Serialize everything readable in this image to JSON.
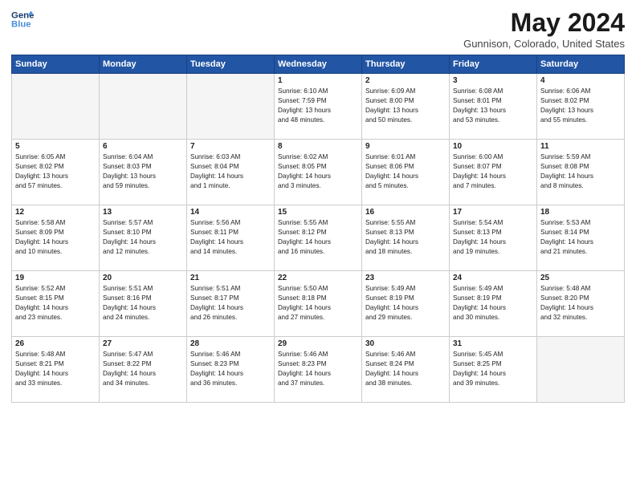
{
  "header": {
    "logo_line1": "General",
    "logo_line2": "Blue",
    "month": "May 2024",
    "location": "Gunnison, Colorado, United States"
  },
  "days_of_week": [
    "Sunday",
    "Monday",
    "Tuesday",
    "Wednesday",
    "Thursday",
    "Friday",
    "Saturday"
  ],
  "weeks": [
    [
      {
        "day": "",
        "info": "",
        "empty": true
      },
      {
        "day": "",
        "info": "",
        "empty": true
      },
      {
        "day": "",
        "info": "",
        "empty": true
      },
      {
        "day": "1",
        "info": "Sunrise: 6:10 AM\nSunset: 7:59 PM\nDaylight: 13 hours\nand 48 minutes.",
        "empty": false
      },
      {
        "day": "2",
        "info": "Sunrise: 6:09 AM\nSunset: 8:00 PM\nDaylight: 13 hours\nand 50 minutes.",
        "empty": false
      },
      {
        "day": "3",
        "info": "Sunrise: 6:08 AM\nSunset: 8:01 PM\nDaylight: 13 hours\nand 53 minutes.",
        "empty": false
      },
      {
        "day": "4",
        "info": "Sunrise: 6:06 AM\nSunset: 8:02 PM\nDaylight: 13 hours\nand 55 minutes.",
        "empty": false
      }
    ],
    [
      {
        "day": "5",
        "info": "Sunrise: 6:05 AM\nSunset: 8:02 PM\nDaylight: 13 hours\nand 57 minutes.",
        "empty": false
      },
      {
        "day": "6",
        "info": "Sunrise: 6:04 AM\nSunset: 8:03 PM\nDaylight: 13 hours\nand 59 minutes.",
        "empty": false
      },
      {
        "day": "7",
        "info": "Sunrise: 6:03 AM\nSunset: 8:04 PM\nDaylight: 14 hours\nand 1 minute.",
        "empty": false
      },
      {
        "day": "8",
        "info": "Sunrise: 6:02 AM\nSunset: 8:05 PM\nDaylight: 14 hours\nand 3 minutes.",
        "empty": false
      },
      {
        "day": "9",
        "info": "Sunrise: 6:01 AM\nSunset: 8:06 PM\nDaylight: 14 hours\nand 5 minutes.",
        "empty": false
      },
      {
        "day": "10",
        "info": "Sunrise: 6:00 AM\nSunset: 8:07 PM\nDaylight: 14 hours\nand 7 minutes.",
        "empty": false
      },
      {
        "day": "11",
        "info": "Sunrise: 5:59 AM\nSunset: 8:08 PM\nDaylight: 14 hours\nand 8 minutes.",
        "empty": false
      }
    ],
    [
      {
        "day": "12",
        "info": "Sunrise: 5:58 AM\nSunset: 8:09 PM\nDaylight: 14 hours\nand 10 minutes.",
        "empty": false
      },
      {
        "day": "13",
        "info": "Sunrise: 5:57 AM\nSunset: 8:10 PM\nDaylight: 14 hours\nand 12 minutes.",
        "empty": false
      },
      {
        "day": "14",
        "info": "Sunrise: 5:56 AM\nSunset: 8:11 PM\nDaylight: 14 hours\nand 14 minutes.",
        "empty": false
      },
      {
        "day": "15",
        "info": "Sunrise: 5:55 AM\nSunset: 8:12 PM\nDaylight: 14 hours\nand 16 minutes.",
        "empty": false
      },
      {
        "day": "16",
        "info": "Sunrise: 5:55 AM\nSunset: 8:13 PM\nDaylight: 14 hours\nand 18 minutes.",
        "empty": false
      },
      {
        "day": "17",
        "info": "Sunrise: 5:54 AM\nSunset: 8:13 PM\nDaylight: 14 hours\nand 19 minutes.",
        "empty": false
      },
      {
        "day": "18",
        "info": "Sunrise: 5:53 AM\nSunset: 8:14 PM\nDaylight: 14 hours\nand 21 minutes.",
        "empty": false
      }
    ],
    [
      {
        "day": "19",
        "info": "Sunrise: 5:52 AM\nSunset: 8:15 PM\nDaylight: 14 hours\nand 23 minutes.",
        "empty": false
      },
      {
        "day": "20",
        "info": "Sunrise: 5:51 AM\nSunset: 8:16 PM\nDaylight: 14 hours\nand 24 minutes.",
        "empty": false
      },
      {
        "day": "21",
        "info": "Sunrise: 5:51 AM\nSunset: 8:17 PM\nDaylight: 14 hours\nand 26 minutes.",
        "empty": false
      },
      {
        "day": "22",
        "info": "Sunrise: 5:50 AM\nSunset: 8:18 PM\nDaylight: 14 hours\nand 27 minutes.",
        "empty": false
      },
      {
        "day": "23",
        "info": "Sunrise: 5:49 AM\nSunset: 8:19 PM\nDaylight: 14 hours\nand 29 minutes.",
        "empty": false
      },
      {
        "day": "24",
        "info": "Sunrise: 5:49 AM\nSunset: 8:19 PM\nDaylight: 14 hours\nand 30 minutes.",
        "empty": false
      },
      {
        "day": "25",
        "info": "Sunrise: 5:48 AM\nSunset: 8:20 PM\nDaylight: 14 hours\nand 32 minutes.",
        "empty": false
      }
    ],
    [
      {
        "day": "26",
        "info": "Sunrise: 5:48 AM\nSunset: 8:21 PM\nDaylight: 14 hours\nand 33 minutes.",
        "empty": false
      },
      {
        "day": "27",
        "info": "Sunrise: 5:47 AM\nSunset: 8:22 PM\nDaylight: 14 hours\nand 34 minutes.",
        "empty": false
      },
      {
        "day": "28",
        "info": "Sunrise: 5:46 AM\nSunset: 8:23 PM\nDaylight: 14 hours\nand 36 minutes.",
        "empty": false
      },
      {
        "day": "29",
        "info": "Sunrise: 5:46 AM\nSunset: 8:23 PM\nDaylight: 14 hours\nand 37 minutes.",
        "empty": false
      },
      {
        "day": "30",
        "info": "Sunrise: 5:46 AM\nSunset: 8:24 PM\nDaylight: 14 hours\nand 38 minutes.",
        "empty": false
      },
      {
        "day": "31",
        "info": "Sunrise: 5:45 AM\nSunset: 8:25 PM\nDaylight: 14 hours\nand 39 minutes.",
        "empty": false
      },
      {
        "day": "",
        "info": "",
        "empty": true
      }
    ]
  ]
}
